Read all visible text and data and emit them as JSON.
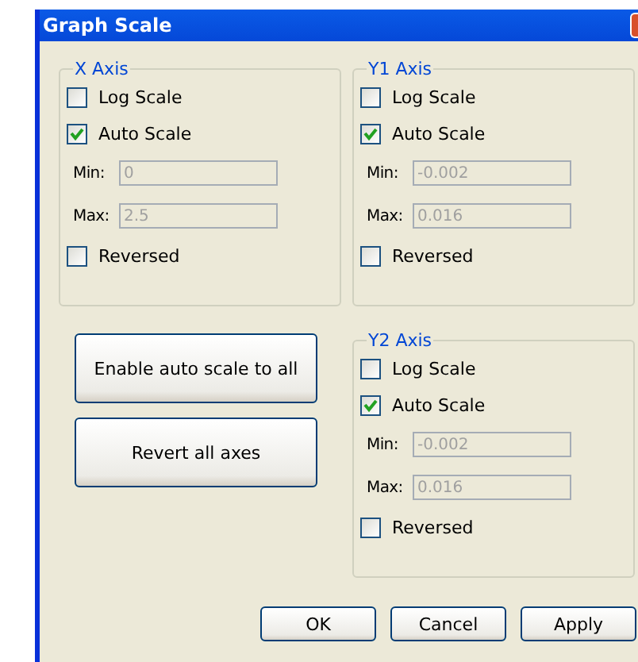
{
  "window": {
    "title": "Graph Scale"
  },
  "axes": [
    {
      "title": "X Axis",
      "log_scale": {
        "label": "Log Scale",
        "checked": false
      },
      "auto_scale": {
        "label": "Auto Scale",
        "checked": true
      },
      "min": {
        "label": "Min:",
        "value": "0",
        "disabled": true
      },
      "max": {
        "label": "Max:",
        "value": "2.5",
        "disabled": true
      },
      "reversed": {
        "label": "Reversed",
        "checked": false
      }
    },
    {
      "title": "Y1 Axis",
      "log_scale": {
        "label": "Log Scale",
        "checked": false
      },
      "auto_scale": {
        "label": "Auto Scale",
        "checked": true
      },
      "min": {
        "label": "Min:",
        "value": "-0.002",
        "disabled": true
      },
      "max": {
        "label": "Max:",
        "value": "0.016",
        "disabled": true
      },
      "reversed": {
        "label": "Reversed",
        "checked": false
      }
    },
    {
      "title": "Y2 Axis",
      "log_scale": {
        "label": "Log Scale",
        "checked": false
      },
      "auto_scale": {
        "label": "Auto Scale",
        "checked": true
      },
      "min": {
        "label": "Min:",
        "value": "-0.002",
        "disabled": true
      },
      "max": {
        "label": "Max:",
        "value": "0.016",
        "disabled": true
      },
      "reversed": {
        "label": "Reversed",
        "checked": false
      }
    }
  ],
  "actions": [
    "Enable auto scale to all",
    "Revert all axes"
  ],
  "buttons": [
    "OK",
    "Cancel",
    "Apply"
  ]
}
